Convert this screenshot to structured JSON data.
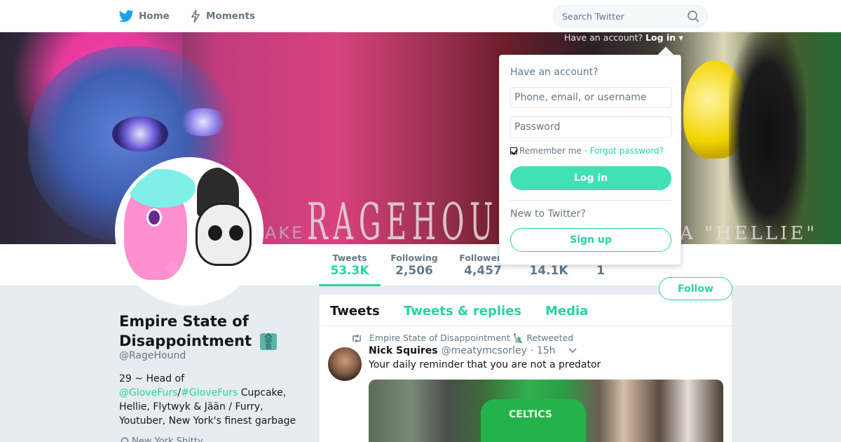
{
  "nav": {
    "home_label": "Home",
    "moments_label": "Moments",
    "search_placeholder": "Search Twitter",
    "have_account_text": "Have an account?",
    "login_link": "Log in ▾"
  },
  "banner": {
    "title_text": "RAGEHOUN",
    "left_fragment": "AKE",
    "right_fragment": "A \"HELLIE\""
  },
  "profile": {
    "name": "Empire State of Disappointment",
    "handle": "@RageHound",
    "bio_prefix": "29 ~ Head of ",
    "bio_link1": "@GloveFurs",
    "bio_sep": "/",
    "bio_link2": "#GloveFurs",
    "bio_suffix": " Cupcake, Hellie, Flytwyk & Jään / Furry, Youtuber, New York's finest garbage",
    "location": "New York Shitty"
  },
  "stats": [
    {
      "label": "Tweets",
      "value": "53.3K"
    },
    {
      "label": "Following",
      "value": "2,506"
    },
    {
      "label": "Followers",
      "value": "4,457"
    },
    {
      "label": "",
      "value": "14.1K"
    },
    {
      "label": "",
      "value": "1"
    }
  ],
  "follow_label": "Follow",
  "timeline": {
    "tabs": [
      "Tweets",
      "Tweets & replies",
      "Media"
    ],
    "retweet_text": "Empire State of Disappointment 🗽 Retweeted",
    "tweet": {
      "name": "Nick Squires",
      "handle": "@meatymcsorley",
      "time": "· 15h",
      "text": "Your daily reminder that you are not a predator",
      "media_text": "CELTICS"
    }
  },
  "login": {
    "title": "Have an account?",
    "username_placeholder": "Phone, email, or username",
    "password_placeholder": "Password",
    "remember_label": "Remember me",
    "separator": "·",
    "forgot_label": "Forgot password?",
    "login_button": "Log in",
    "new_to_label": "New to Twitter?",
    "signup_button": "Sign up"
  },
  "colors": {
    "accent": "#24d4a4",
    "accent_button": "#3fe0b4",
    "twitter_blue": "#1da1f2",
    "muted": "#657786"
  }
}
